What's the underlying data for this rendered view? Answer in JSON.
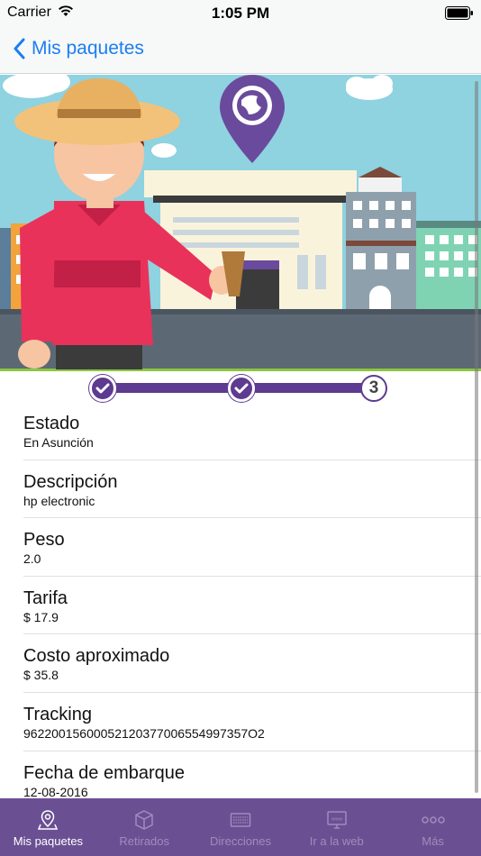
{
  "status_bar": {
    "carrier": "Carrier",
    "time": "1:05 PM"
  },
  "nav": {
    "back_label": "Mis paquetes"
  },
  "progress": {
    "current_step": "3",
    "completed_steps": 2,
    "total_steps": 3
  },
  "details": [
    {
      "label": "Estado",
      "value": "En Asunción"
    },
    {
      "label": "Descripción",
      "value": "hp electronic"
    },
    {
      "label": "Peso",
      "value": "2.0"
    },
    {
      "label": "Tarifa",
      "value": "$ 17.9"
    },
    {
      "label": "Costo aproximado",
      "value": "$ 35.8"
    },
    {
      "label": "Tracking",
      "value": "96220015600052120377006554997357O2"
    },
    {
      "label": "Fecha de embarque",
      "value": "12-08-2016"
    }
  ],
  "tabs": [
    {
      "label": "Mis paquetes",
      "icon": "map-pin-icon",
      "active": true
    },
    {
      "label": "Retirados",
      "icon": "box-icon",
      "active": false
    },
    {
      "label": "Direcciones",
      "icon": "keyboard-icon",
      "active": false
    },
    {
      "label": "Ir a la web",
      "icon": "monitor-icon",
      "active": false
    },
    {
      "label": "Más",
      "icon": "more-icon",
      "active": false
    }
  ],
  "colors": {
    "accent": "#5e3a91",
    "tab_bar": "#6b4f93",
    "link": "#1b7ef2",
    "sky": "#8fd2e0"
  }
}
